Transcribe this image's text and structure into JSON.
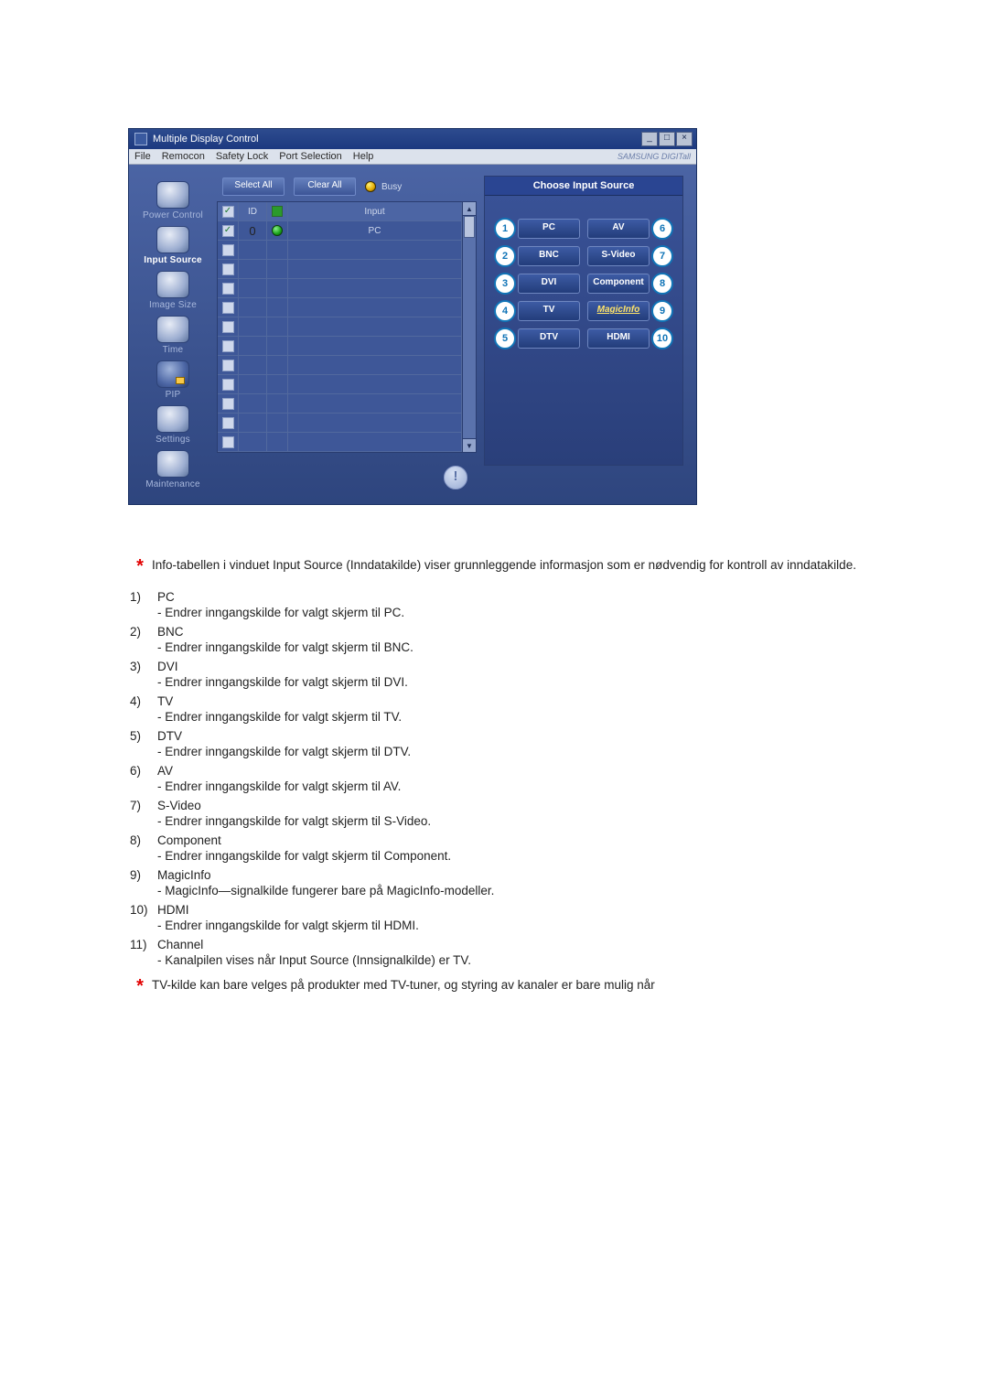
{
  "app": {
    "title": "Multiple Display Control",
    "brand": "SAMSUNG DIGITall",
    "menu": [
      "File",
      "Remocon",
      "Safety Lock",
      "Port Selection",
      "Help"
    ],
    "window_buttons": [
      "_",
      "□",
      "×"
    ]
  },
  "sidebar": {
    "items": [
      {
        "label": "Power Control",
        "active": false
      },
      {
        "label": "Input Source",
        "active": true
      },
      {
        "label": "Image Size",
        "active": false
      },
      {
        "label": "Time",
        "active": false
      },
      {
        "label": "PIP",
        "active": false
      },
      {
        "label": "Settings",
        "active": false
      },
      {
        "label": "Maintenance",
        "active": false
      }
    ]
  },
  "toolbar": {
    "select_all": "Select All",
    "clear_all": "Clear All",
    "busy": "Busy"
  },
  "table": {
    "headers": {
      "check": "✓",
      "id": "ID",
      "status": " ",
      "input": "Input"
    },
    "rows": [
      {
        "checked": true,
        "id": "0",
        "status": "green",
        "input": "PC"
      },
      {
        "checked": false,
        "id": "",
        "status": "",
        "input": ""
      },
      {
        "checked": false,
        "id": "",
        "status": "",
        "input": ""
      },
      {
        "checked": false,
        "id": "",
        "status": "",
        "input": ""
      },
      {
        "checked": false,
        "id": "",
        "status": "",
        "input": ""
      },
      {
        "checked": false,
        "id": "",
        "status": "",
        "input": ""
      },
      {
        "checked": false,
        "id": "",
        "status": "",
        "input": ""
      },
      {
        "checked": false,
        "id": "",
        "status": "",
        "input": ""
      },
      {
        "checked": false,
        "id": "",
        "status": "",
        "input": ""
      },
      {
        "checked": false,
        "id": "",
        "status": "",
        "input": ""
      },
      {
        "checked": false,
        "id": "",
        "status": "",
        "input": ""
      },
      {
        "checked": false,
        "id": "",
        "status": "",
        "input": ""
      }
    ]
  },
  "panel": {
    "title": "Choose Input Source",
    "left": [
      {
        "n": "1",
        "t": "PC"
      },
      {
        "n": "2",
        "t": "BNC"
      },
      {
        "n": "3",
        "t": "DVI"
      },
      {
        "n": "4",
        "t": "TV"
      },
      {
        "n": "5",
        "t": "DTV"
      }
    ],
    "right": [
      {
        "n": "6",
        "t": "AV"
      },
      {
        "n": "7",
        "t": "S-Video"
      },
      {
        "n": "8",
        "t": "Component"
      },
      {
        "n": "9",
        "t": "MagicInfo"
      },
      {
        "n": "10",
        "t": "HDMI"
      }
    ]
  },
  "info_icon": "!",
  "notes": {
    "intro": "Info-tabellen i vinduet Input Source (Inndatakilde) viser grunnleggende informasjon som er nødvendig for kontroll av inndatakilde.",
    "footer": "TV-kilde kan bare velges på produkter med TV-tuner, og styring av kanaler er bare mulig når"
  },
  "list": [
    {
      "no": "1)",
      "title": "PC",
      "desc": "- Endrer inngangskilde for valgt skjerm til PC."
    },
    {
      "no": "2)",
      "title": "BNC",
      "desc": "- Endrer inngangskilde for valgt skjerm til BNC."
    },
    {
      "no": "3)",
      "title": "DVI",
      "desc": "- Endrer inngangskilde for valgt skjerm til DVI."
    },
    {
      "no": "4)",
      "title": "TV",
      "desc": "- Endrer inngangskilde for valgt skjerm til TV."
    },
    {
      "no": "5)",
      "title": "DTV",
      "desc": "- Endrer inngangskilde for valgt skjerm til DTV."
    },
    {
      "no": "6)",
      "title": "AV",
      "desc": "- Endrer inngangskilde for valgt skjerm til AV."
    },
    {
      "no": "7)",
      "title": "S-Video",
      "desc": "- Endrer inngangskilde for valgt skjerm til S-Video."
    },
    {
      "no": "8)",
      "title": "Component",
      "desc": "- Endrer inngangskilde for valgt skjerm til Component."
    },
    {
      "no": "9)",
      "title": "MagicInfo",
      "desc": "- MagicInfo—signalkilde fungerer bare på MagicInfo-modeller."
    },
    {
      "no": "10)",
      "title": "HDMI",
      "desc": "- Endrer inngangskilde for valgt skjerm til HDMI."
    },
    {
      "no": "11)",
      "title": "Channel",
      "desc": "- Kanalpilen vises når Input Source (Innsignalkilde) er TV."
    }
  ]
}
